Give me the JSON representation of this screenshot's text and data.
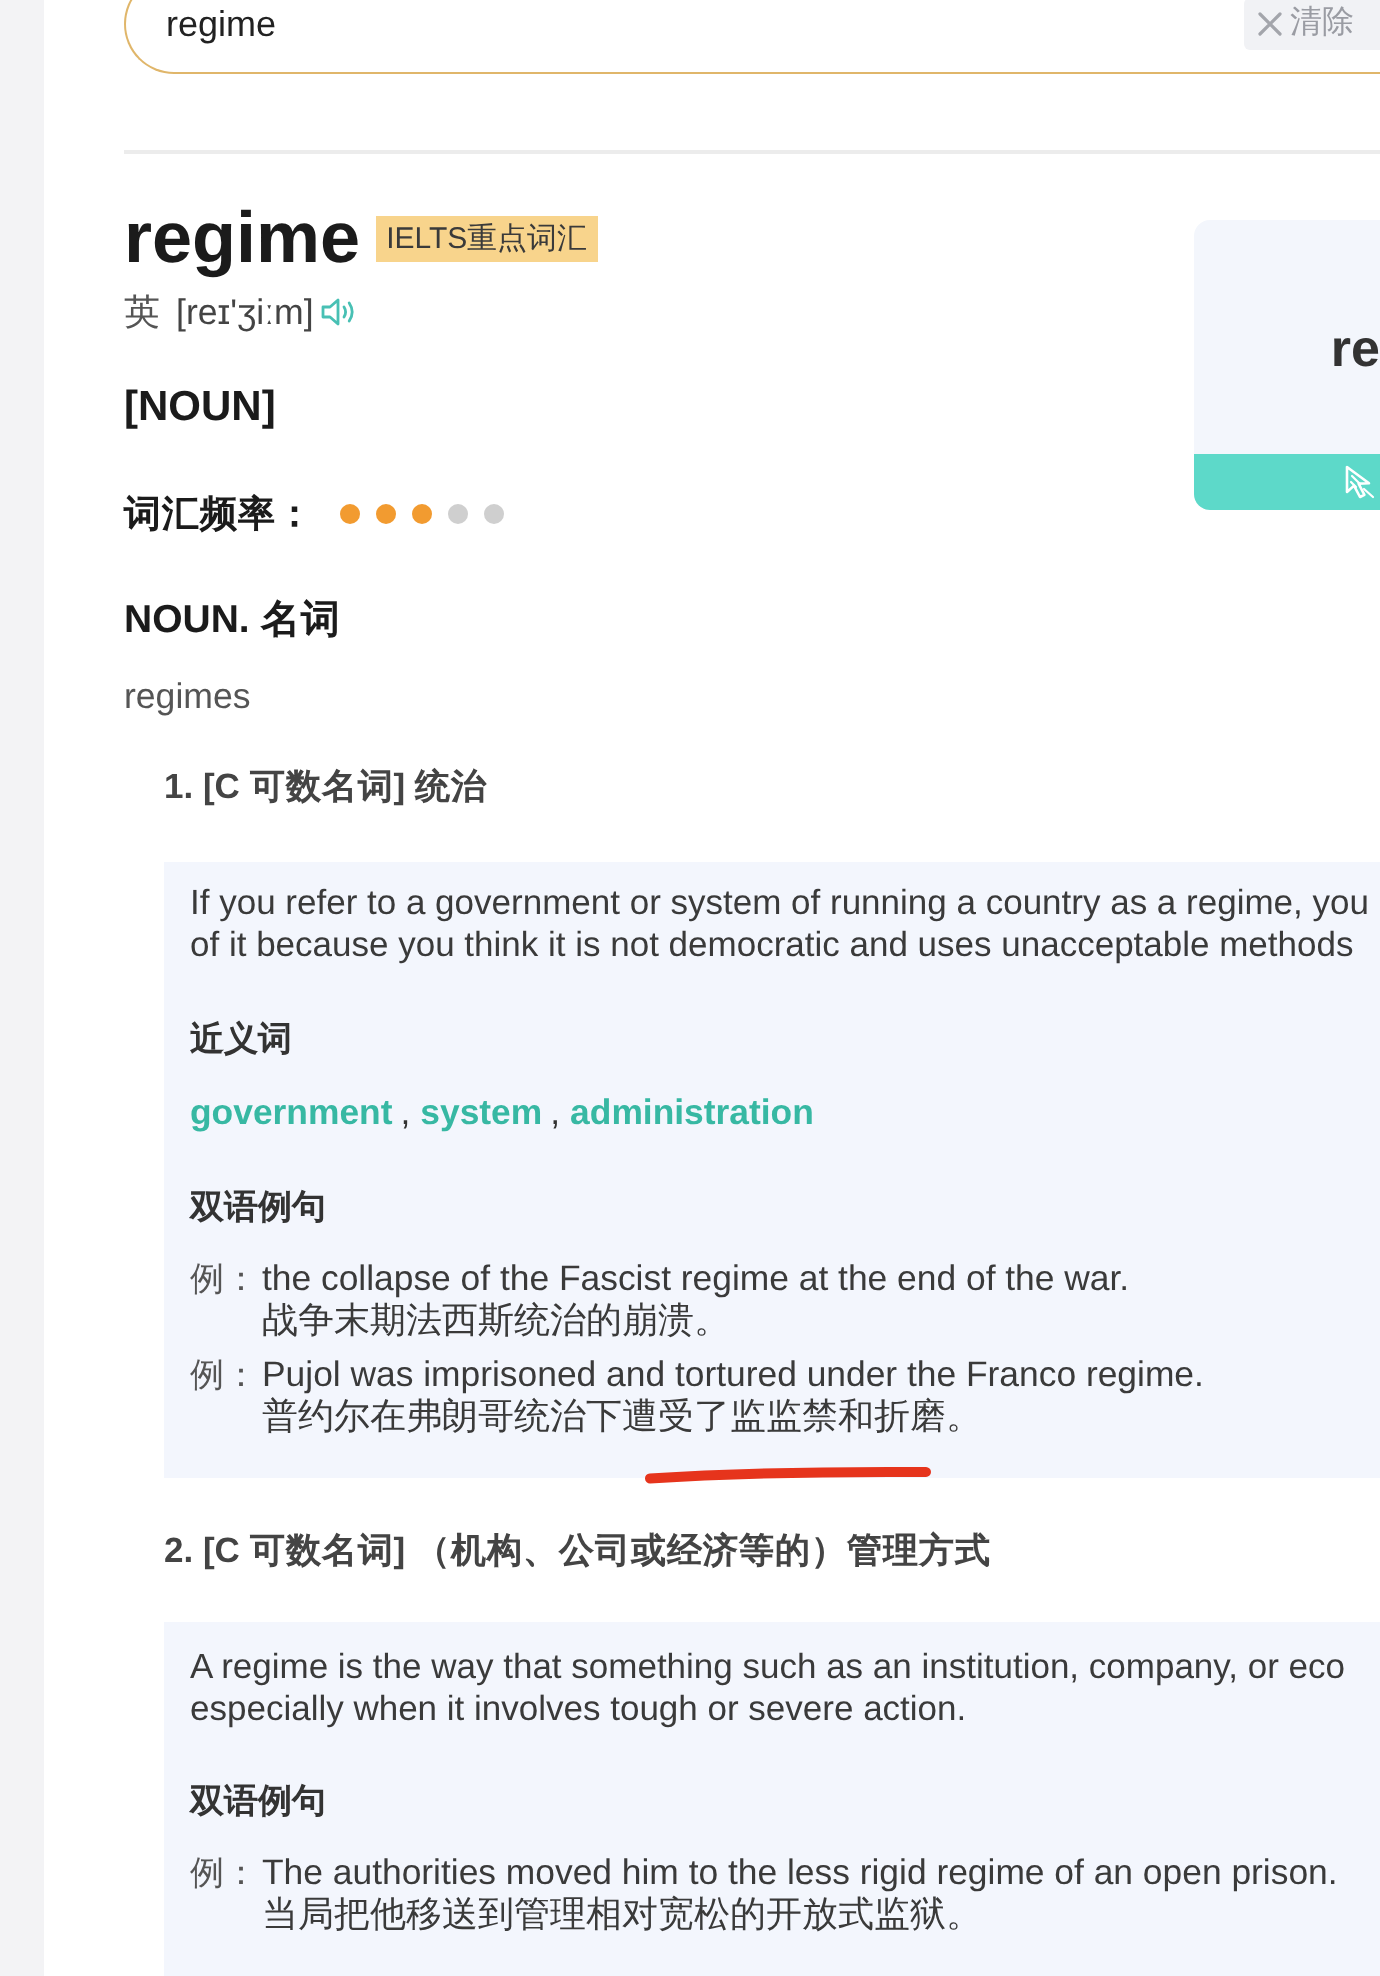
{
  "search": {
    "value": "regime",
    "clear_label": "清除"
  },
  "entry": {
    "word": "regime",
    "badge": "IELTS重点词汇",
    "region": "英",
    "phonetic": "[reɪ'ʒiːm]",
    "word_class": "[NOUN]",
    "frequency": {
      "label": "词汇频率：",
      "stars": 3
    }
  },
  "side_card": {
    "title": "re"
  },
  "part_of_speech": {
    "heading": "NOUN. 名词",
    "form": "regimes"
  },
  "senses": [
    {
      "heading": "1. [C 可数名词] 统治",
      "definition": "If you refer to a government or system of running a country as a regime, you\nof it because you think it is not democratic and uses unacceptable methods",
      "synonyms": {
        "heading": "近义词",
        "items": [
          {
            "kind": "word",
            "text": "government"
          },
          {
            "kind": "separator",
            "text": ","
          },
          {
            "kind": "word",
            "text": "system"
          },
          {
            "kind": "separator",
            "text": ","
          },
          {
            "kind": "word",
            "text": "administration"
          }
        ]
      },
      "examples": {
        "heading": "双语例句",
        "items": [
          {
            "marker": "例：",
            "en": "the collapse of the Fascist regime at the end of the war.",
            "zh": "战争末期法西斯统治的崩溃。",
            "annotated": false
          },
          {
            "marker": "例：",
            "en": "Pujol was imprisoned and tortured under the Franco regime.",
            "zh": "普约尔在弗朗哥统治下遭受了监监禁和折磨。",
            "annotated": true
          }
        ]
      }
    },
    {
      "heading": "2. [C 可数名词] （机构、公司或经济等的）管理方式",
      "definition": "A regime is the way that something such as an institution, company, or eco\nespecially when it involves tough or severe action.",
      "examples": {
        "heading": "双语例句",
        "items": [
          {
            "marker": "例：",
            "en": "The authorities moved him to the less rigid regime of an open prison.",
            "zh": "当局把他移送到管理相对宽松的开放式监狱。",
            "annotated": false
          }
        ]
      }
    }
  ]
}
